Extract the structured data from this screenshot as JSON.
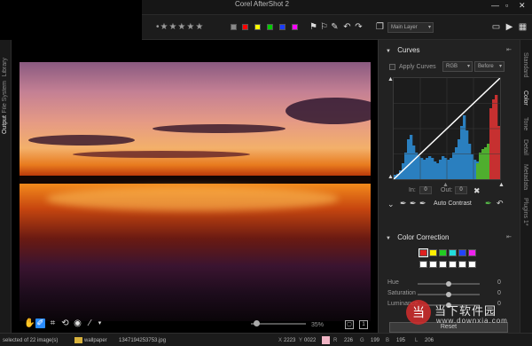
{
  "window": {
    "title": "Corel AfterShot 2"
  },
  "toolbar": {
    "rating_stars": "•★★★★★",
    "color_labels": [
      "#888888",
      "#ff0000",
      "#ffff00",
      "#00cc00",
      "#1a3cff",
      "#ff00ff"
    ],
    "layer_select": "Main Layer"
  },
  "left_tabs": [
    "Output",
    "File System",
    "Library"
  ],
  "viewer": {
    "zoom": "35%",
    "zoom_fraction": 0.1
  },
  "curves": {
    "title": "Curves",
    "apply_label": "Apply Curves",
    "channel": "RGB",
    "compare": "Before",
    "in_label": "In:",
    "out_label": "Out:",
    "in_value": "0",
    "out_value": "0",
    "auto_contrast": "Auto Contrast",
    "histogram": {
      "blue": [
        5,
        6,
        10,
        18,
        30,
        45,
        50,
        38,
        30,
        26,
        24,
        22,
        24,
        26,
        24,
        20,
        18,
        22,
        26,
        24,
        22,
        24,
        30,
        36,
        45,
        60,
        72,
        55,
        40,
        28,
        22,
        20,
        18,
        16,
        15,
        16,
        18,
        14,
        10,
        8
      ],
      "green": [
        0,
        0,
        0,
        0,
        0,
        0,
        0,
        0,
        0,
        0,
        0,
        0,
        0,
        0,
        0,
        0,
        0,
        0,
        0,
        0,
        0,
        0,
        0,
        0,
        0,
        0,
        0,
        0,
        0,
        0,
        0,
        18,
        30,
        34,
        36,
        40,
        46,
        50,
        44,
        30
      ],
      "red": [
        0,
        0,
        0,
        0,
        0,
        0,
        0,
        0,
        0,
        0,
        0,
        0,
        0,
        0,
        0,
        0,
        0,
        0,
        0,
        0,
        0,
        0,
        0,
        0,
        0,
        0,
        0,
        0,
        0,
        0,
        0,
        0,
        0,
        0,
        0,
        0,
        80,
        90,
        95,
        60
      ]
    }
  },
  "color_correction": {
    "title": "Color Correction",
    "swatches_top": [
      "#e02020",
      "#ffee00",
      "#22cc22",
      "#22dddd",
      "#2244ff",
      "#ee22ee"
    ],
    "swatches_bottom": [
      "#ffffff",
      "#ffffff",
      "#ffffff",
      "#ffffff",
      "#ffffff",
      "#ffffff"
    ],
    "sliders": [
      {
        "label": "Hue",
        "value": "0",
        "fraction": 0.5
      },
      {
        "label": "Saturation",
        "value": "0",
        "fraction": 0.5
      },
      {
        "label": "Luminance",
        "value": "0",
        "fraction": 0.5
      }
    ],
    "reset_label": "Reset"
  },
  "right_tabs": [
    "Standard",
    "Color",
    "Tone",
    "Detail",
    "Metadata",
    "Plugins 1*"
  ],
  "status": {
    "selection": "selected of 22 image(s)",
    "folder": "wallpaper",
    "filename": "1347194253753.jpg",
    "x_label": "X",
    "x": "2223",
    "y_label": "Y",
    "y": "0022",
    "r_label": "R",
    "r": "226",
    "g_label": "G",
    "g": "199",
    "b_label": "B",
    "b": "195",
    "l_label": "L",
    "l": "206"
  },
  "watermark": {
    "glyph": "当",
    "text": "当下软件园",
    "url": "www.downxia.com"
  }
}
